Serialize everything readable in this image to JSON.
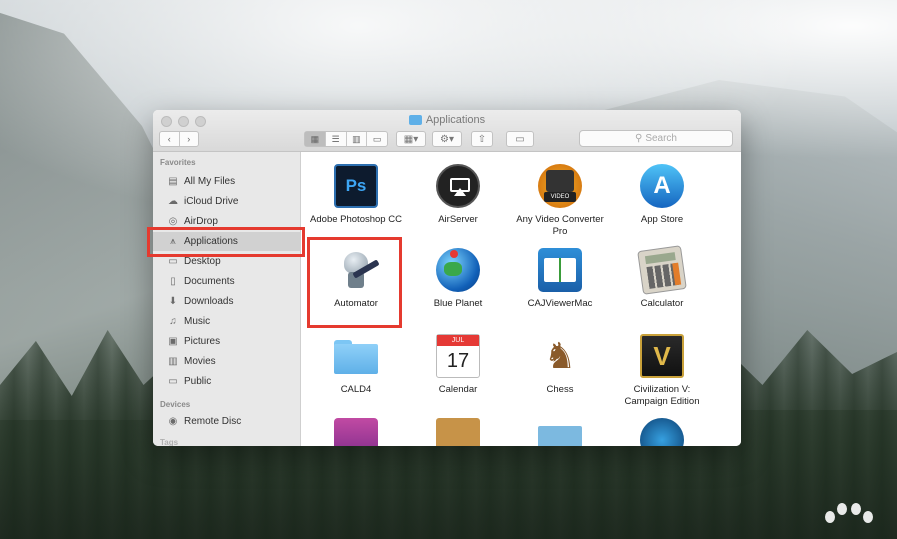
{
  "window": {
    "title": "Applications",
    "search_placeholder": "Search"
  },
  "sidebar": {
    "favorites_heading": "Favorites",
    "devices_heading": "Devices",
    "tags_heading": "Tags",
    "items": [
      {
        "label": "All My Files",
        "icon": "all-files-icon"
      },
      {
        "label": "iCloud Drive",
        "icon": "cloud-icon"
      },
      {
        "label": "AirDrop",
        "icon": "airdrop-icon"
      },
      {
        "label": "Applications",
        "icon": "applications-icon",
        "selected": true
      },
      {
        "label": "Desktop",
        "icon": "desktop-icon"
      },
      {
        "label": "Documents",
        "icon": "documents-icon"
      },
      {
        "label": "Downloads",
        "icon": "downloads-icon"
      },
      {
        "label": "Music",
        "icon": "music-icon"
      },
      {
        "label": "Pictures",
        "icon": "pictures-icon"
      },
      {
        "label": "Movies",
        "icon": "movies-icon"
      },
      {
        "label": "Public",
        "icon": "public-folder-icon"
      }
    ],
    "devices": [
      {
        "label": "Remote Disc",
        "icon": "remote-disc-icon"
      }
    ]
  },
  "apps": [
    {
      "label": "Adobe Photoshop CC",
      "icon": "photoshop-icon",
      "icon_text": "Ps"
    },
    {
      "label": "AirServer",
      "icon": "airserver-icon"
    },
    {
      "label": "Any Video Converter Pro",
      "icon": "video-converter-icon",
      "icon_text": "VIDEO"
    },
    {
      "label": "App Store",
      "icon": "app-store-icon"
    },
    {
      "label": "Automator",
      "icon": "automator-icon"
    },
    {
      "label": "Blue Planet",
      "icon": "blue-planet-icon"
    },
    {
      "label": "CAJViewerMac",
      "icon": "cajviewer-icon"
    },
    {
      "label": "Calculator",
      "icon": "calculator-icon"
    },
    {
      "label": "CALD4",
      "icon": "folder-icon"
    },
    {
      "label": "Calendar",
      "icon": "calendar-icon",
      "icon_month": "JUL",
      "icon_day": "17"
    },
    {
      "label": "Chess",
      "icon": "chess-icon"
    },
    {
      "label": "Civilization V: Campaign Edition",
      "icon": "civilization-icon"
    }
  ],
  "colors": {
    "highlight": "#e53a2f",
    "folder": "#5fb0e8",
    "selection": "#d1d1d1"
  }
}
